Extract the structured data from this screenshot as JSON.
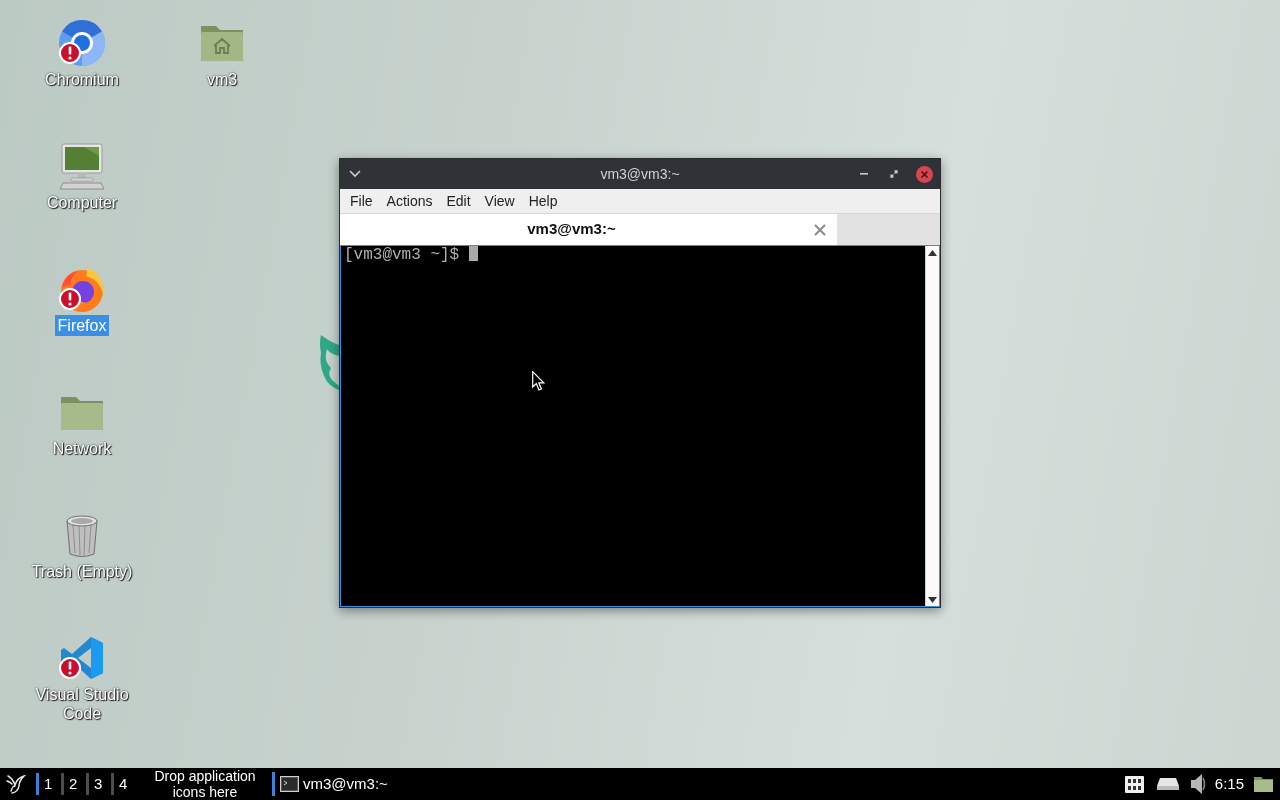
{
  "desktop": {
    "icons": [
      {
        "label": "Chromium",
        "kind": "chromium",
        "warning": true,
        "selected": false
      },
      {
        "label": "Computer",
        "kind": "computer",
        "warning": false,
        "selected": false
      },
      {
        "label": "Firefox",
        "kind": "firefox",
        "warning": true,
        "selected": true
      },
      {
        "label": "Network",
        "kind": "folder",
        "warning": false,
        "selected": false
      },
      {
        "label": "Trash (Empty)",
        "kind": "trash",
        "warning": false,
        "selected": false
      },
      {
        "label": "Visual Studio Code",
        "kind": "vscode",
        "warning": true,
        "selected": false
      },
      {
        "label": "vm3",
        "kind": "home",
        "warning": false,
        "selected": false
      }
    ]
  },
  "window": {
    "title": "vm3@vm3:~",
    "menu": [
      "File",
      "Actions",
      "Edit",
      "View",
      "Help"
    ],
    "tabs": [
      {
        "label": "vm3@vm3:~",
        "selected": true
      }
    ],
    "terminal": {
      "prompt": "[vm3@vm3 ~]$"
    }
  },
  "taskbar": {
    "workspaces": [
      {
        "label": "1",
        "selected": true
      },
      {
        "label": "2",
        "selected": false
      },
      {
        "label": "3",
        "selected": false
      },
      {
        "label": "4",
        "selected": false
      }
    ],
    "launcher_hint": "Drop application icons here",
    "tasks": [
      {
        "label": "vm3@vm3:~",
        "selected": true
      }
    ],
    "clock": "6:15"
  }
}
